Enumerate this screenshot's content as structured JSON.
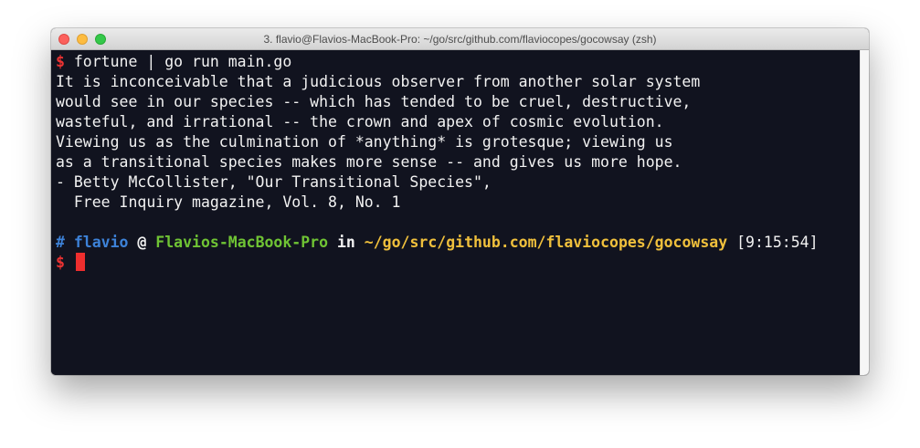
{
  "window": {
    "title": "3. flavio@Flavios-MacBook-Pro: ~/go/src/github.com/flaviocopes/gocowsay (zsh)"
  },
  "terminal": {
    "command_prompt_symbol": "$",
    "command": " fortune | go run main.go",
    "output_lines": [
      "It is inconceivable that a judicious observer from another solar system",
      "would see in our species -- which has tended to be cruel, destructive,",
      "wasteful, and irrational -- the crown and apex of cosmic evolution.",
      "Viewing us as the culmination of *anything* is grotesque; viewing us",
      "as a transitional species makes more sense -- and gives us more hope.",
      "- Betty McCollister, \"Our Transitional Species\",",
      "  Free Inquiry magazine, Vol. 8, No. 1"
    ],
    "prompt": {
      "hash": "#",
      "user": "flavio",
      "at": "@",
      "host": "Flavios-MacBook-Pro",
      "in": "in",
      "path": "~/go/src/github.com/flaviocopes/gocowsay",
      "time": "[9:15:54]"
    },
    "input_prompt_symbol": "$"
  },
  "colors": {
    "background": "#11131f",
    "prompt_symbol": "#ee3333",
    "user": "#3d82d8",
    "host": "#6fc334",
    "path": "#f0c03c",
    "cursor": "#ee2e2e"
  }
}
